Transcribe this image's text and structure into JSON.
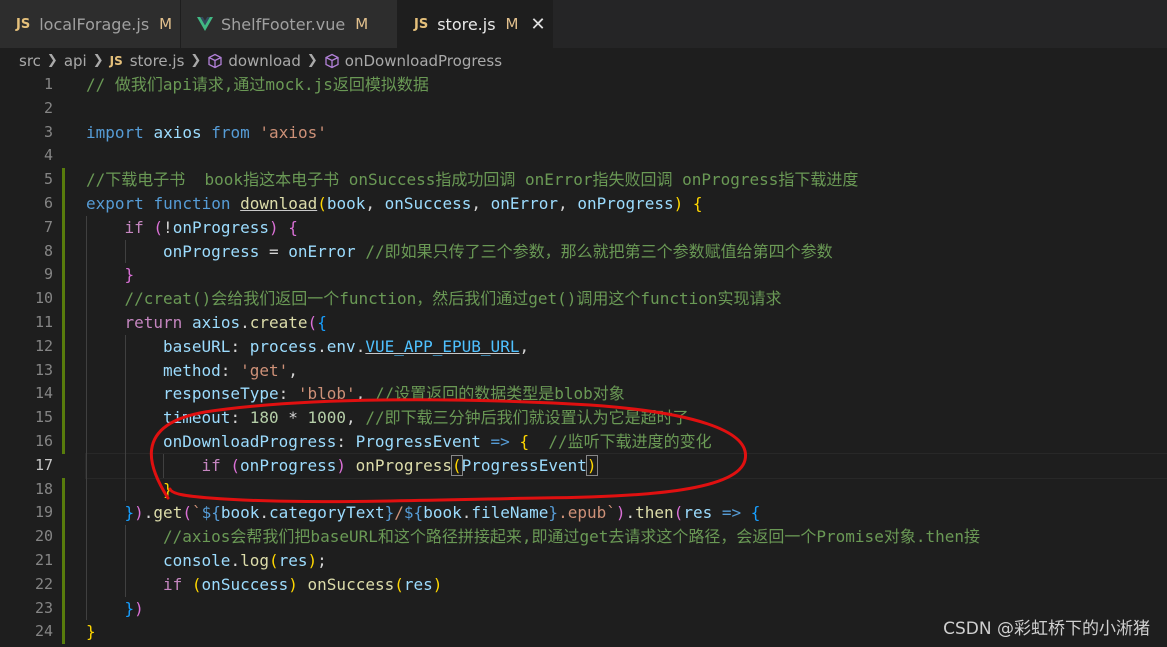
{
  "tabs": [
    {
      "icon": "JS",
      "label": "localForage.js",
      "modified": "M"
    },
    {
      "icon": "vue-icon",
      "label": "ShelfFooter.vue",
      "modified": "M"
    },
    {
      "icon": "JS",
      "label": "store.js",
      "modified": "M",
      "close": "✕"
    }
  ],
  "breadcrumb": {
    "src": "src",
    "api": "api",
    "file_icon": "JS",
    "file": "store.js",
    "symbol1": "download",
    "symbol2": "onDownloadProgress"
  },
  "code_lines": [
    {
      "n": "1",
      "indent": 0,
      "tokens": [
        [
          "c",
          "// 做我们api请求,通过mock.js返回模拟数据"
        ]
      ]
    },
    {
      "n": "2",
      "indent": 0,
      "tokens": []
    },
    {
      "n": "3",
      "indent": 0,
      "tokens": [
        [
          "k",
          "import"
        ],
        [
          "p",
          " "
        ],
        [
          "v",
          "axios"
        ],
        [
          "p",
          " "
        ],
        [
          "k",
          "from"
        ],
        [
          "p",
          " "
        ],
        [
          "s",
          "'axios'"
        ]
      ]
    },
    {
      "n": "4",
      "indent": 0,
      "tokens": []
    },
    {
      "n": "5",
      "indent": 0,
      "tokens": [
        [
          "c",
          "//下载电子书  book指这本电子书 onSuccess指成功回调 onError指失败回调 onProgress指下载进度"
        ]
      ]
    },
    {
      "n": "6",
      "indent": 0,
      "tokens": [
        [
          "k",
          "export"
        ],
        [
          "p",
          " "
        ],
        [
          "k",
          "function"
        ],
        [
          "p",
          " "
        ],
        [
          "fu",
          "download"
        ],
        [
          "b1",
          "("
        ],
        [
          "v",
          "book"
        ],
        [
          "p",
          ", "
        ],
        [
          "v",
          "onSuccess"
        ],
        [
          "p",
          ", "
        ],
        [
          "v",
          "onError"
        ],
        [
          "p",
          ", "
        ],
        [
          "v",
          "onProgress"
        ],
        [
          "b1",
          ")"
        ],
        [
          "p",
          " "
        ],
        [
          "b1",
          "{"
        ]
      ]
    },
    {
      "n": "7",
      "indent": 1,
      "tokens": [
        [
          "ct",
          "if"
        ],
        [
          "p",
          " "
        ],
        [
          "b2",
          "("
        ],
        [
          "p",
          "!"
        ],
        [
          "v",
          "onProgress"
        ],
        [
          "b2",
          ")"
        ],
        [
          "p",
          " "
        ],
        [
          "b2",
          "{"
        ]
      ]
    },
    {
      "n": "8",
      "indent": 2,
      "tokens": [
        [
          "v",
          "onProgress"
        ],
        [
          "p",
          " = "
        ],
        [
          "v",
          "onError"
        ],
        [
          "p",
          " "
        ],
        [
          "c",
          "//即如果只传了三个参数，那么就把第三个参数赋值给第四个参数"
        ]
      ]
    },
    {
      "n": "9",
      "indent": 1,
      "tokens": [
        [
          "b2",
          "}"
        ]
      ]
    },
    {
      "n": "10",
      "indent": 1,
      "tokens": [
        [
          "c",
          "//creat()会给我们返回一个function，然后我们通过get()调用这个function实现请求"
        ]
      ]
    },
    {
      "n": "11",
      "indent": 1,
      "tokens": [
        [
          "ct",
          "return"
        ],
        [
          "p",
          " "
        ],
        [
          "v",
          "axios"
        ],
        [
          "p",
          "."
        ],
        [
          "f",
          "create"
        ],
        [
          "b2",
          "("
        ],
        [
          "b3",
          "{"
        ]
      ]
    },
    {
      "n": "12",
      "indent": 2,
      "tokens": [
        [
          "v",
          "baseURL"
        ],
        [
          "p",
          ": "
        ],
        [
          "v",
          "process"
        ],
        [
          "p",
          "."
        ],
        [
          "v",
          "env"
        ],
        [
          "p",
          "."
        ],
        [
          "cu",
          "VUE_APP_EPUB_URL"
        ],
        [
          "p",
          ","
        ]
      ]
    },
    {
      "n": "13",
      "indent": 2,
      "tokens": [
        [
          "v",
          "method"
        ],
        [
          "p",
          ": "
        ],
        [
          "s",
          "'get'"
        ],
        [
          "p",
          ","
        ]
      ]
    },
    {
      "n": "14",
      "indent": 2,
      "tokens": [
        [
          "v",
          "responseType"
        ],
        [
          "p",
          ": "
        ],
        [
          "s",
          "'blob'"
        ],
        [
          "p",
          ", "
        ],
        [
          "c",
          "//设置返回的数据类型是blob对象"
        ]
      ]
    },
    {
      "n": "15",
      "indent": 2,
      "tokens": [
        [
          "v",
          "timeout"
        ],
        [
          "p",
          ": "
        ],
        [
          "nm",
          "180"
        ],
        [
          "p",
          " * "
        ],
        [
          "nm",
          "1000"
        ],
        [
          "p",
          ", "
        ],
        [
          "c",
          "//即下载三分钟后我们就设置认为它是超时了"
        ]
      ]
    },
    {
      "n": "16",
      "indent": 2,
      "tokens": [
        [
          "v",
          "onDownloadProgress"
        ],
        [
          "p",
          ": "
        ],
        [
          "v",
          "ProgressEvent"
        ],
        [
          "p",
          " "
        ],
        [
          "k",
          "=>"
        ],
        [
          "p",
          " "
        ],
        [
          "b1",
          "{"
        ],
        [
          "p",
          "  "
        ],
        [
          "c",
          "//监听下载进度的变化"
        ]
      ]
    },
    {
      "n": "17",
      "indent": 3,
      "current": true,
      "tokens": [
        [
          "ct",
          "if"
        ],
        [
          "p",
          " "
        ],
        [
          "b2",
          "("
        ],
        [
          "v",
          "onProgress"
        ],
        [
          "b2",
          ")"
        ],
        [
          "p",
          " "
        ],
        [
          "f",
          "onProgress"
        ],
        [
          "bm",
          "("
        ],
        [
          "v",
          "ProgressEvent"
        ],
        [
          "bm",
          ")"
        ]
      ]
    },
    {
      "n": "18",
      "indent": 2,
      "tokens": [
        [
          "b1",
          "}"
        ]
      ]
    },
    {
      "n": "19",
      "indent": 1,
      "tokens": [
        [
          "b3",
          "}"
        ],
        [
          "b2",
          ")"
        ],
        [
          "p",
          "."
        ],
        [
          "f",
          "get"
        ],
        [
          "b2",
          "("
        ],
        [
          "s",
          "`"
        ],
        [
          "k",
          "${"
        ],
        [
          "v",
          "book"
        ],
        [
          "p",
          "."
        ],
        [
          "v",
          "categoryText"
        ],
        [
          "k",
          "}"
        ],
        [
          "s",
          "/"
        ],
        [
          "k",
          "${"
        ],
        [
          "v",
          "book"
        ],
        [
          "p",
          "."
        ],
        [
          "v",
          "fileName"
        ],
        [
          "k",
          "}"
        ],
        [
          "s",
          ".epub`"
        ],
        [
          "b2",
          ")"
        ],
        [
          "p",
          "."
        ],
        [
          "f",
          "then"
        ],
        [
          "b2",
          "("
        ],
        [
          "v",
          "res"
        ],
        [
          "p",
          " "
        ],
        [
          "k",
          "=>"
        ],
        [
          "p",
          " "
        ],
        [
          "b3",
          "{"
        ]
      ]
    },
    {
      "n": "20",
      "indent": 2,
      "tokens": [
        [
          "c",
          "//axios会帮我们把baseURL和这个路径拼接起来,即通过get去请求这个路径，会返回一个Promise对象.then接"
        ]
      ]
    },
    {
      "n": "21",
      "indent": 2,
      "tokens": [
        [
          "v",
          "console"
        ],
        [
          "p",
          "."
        ],
        [
          "f",
          "log"
        ],
        [
          "b1",
          "("
        ],
        [
          "v",
          "res"
        ],
        [
          "b1",
          ")"
        ],
        [
          "p",
          ";"
        ]
      ]
    },
    {
      "n": "22",
      "indent": 2,
      "tokens": [
        [
          "ct",
          "if"
        ],
        [
          "p",
          " "
        ],
        [
          "b1",
          "("
        ],
        [
          "v",
          "onSuccess"
        ],
        [
          "b1",
          ")"
        ],
        [
          "p",
          " "
        ],
        [
          "f",
          "onSuccess"
        ],
        [
          "b1",
          "("
        ],
        [
          "v",
          "res"
        ],
        [
          "b1",
          ")"
        ]
      ]
    },
    {
      "n": "23",
      "indent": 1,
      "tokens": [
        [
          "b3",
          "}"
        ],
        [
          "b2",
          ")"
        ]
      ]
    },
    {
      "n": "24",
      "indent": 0,
      "tokens": [
        [
          "b1",
          "}"
        ]
      ]
    }
  ],
  "colors": {
    "accent_modified": "#e2c08d",
    "git_bar": "#587c0c",
    "annotation": "#e01010"
  },
  "watermark": "CSDN @彩虹桥下的小淅猪"
}
